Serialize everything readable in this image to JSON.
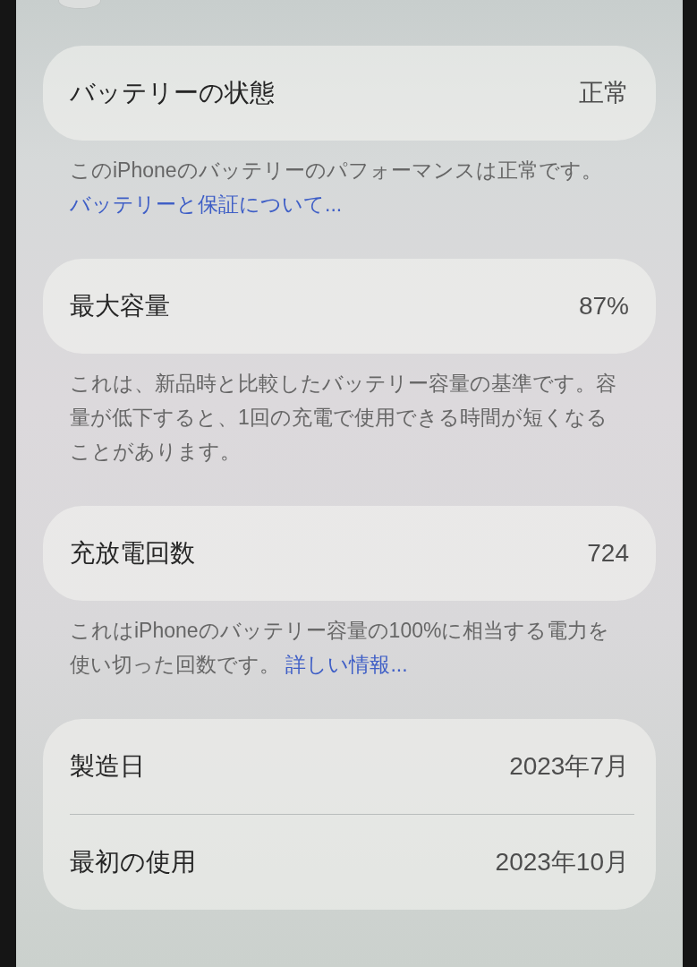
{
  "sections": [
    {
      "rows": [
        {
          "label": "バッテリーの状態",
          "value": "正常"
        }
      ],
      "footer": {
        "lines": [
          "このiPhoneのバッテリーのパフォーマンスは正常です。"
        ],
        "link": "バッテリーと保証について..."
      }
    },
    {
      "rows": [
        {
          "label": "最大容量",
          "value": "87%"
        }
      ],
      "footer": {
        "lines": [
          "これは、新品時と比較したバッテリー容量の基準です。容",
          "量が低下すると、1回の充電で使用できる時間が短くなる",
          "ことがあります。"
        ]
      }
    },
    {
      "rows": [
        {
          "label": "充放電回数",
          "value": "724"
        }
      ],
      "footer": {
        "lines": [
          "これはiPhoneのバッテリー容量の100%に相当する電力を",
          "使い切った回数です。"
        ],
        "link": "詳しい情報..."
      }
    },
    {
      "rows": [
        {
          "label": "製造日",
          "value": "2023年7月"
        },
        {
          "label": "最初の使用",
          "value": "2023年10月"
        }
      ]
    }
  ]
}
